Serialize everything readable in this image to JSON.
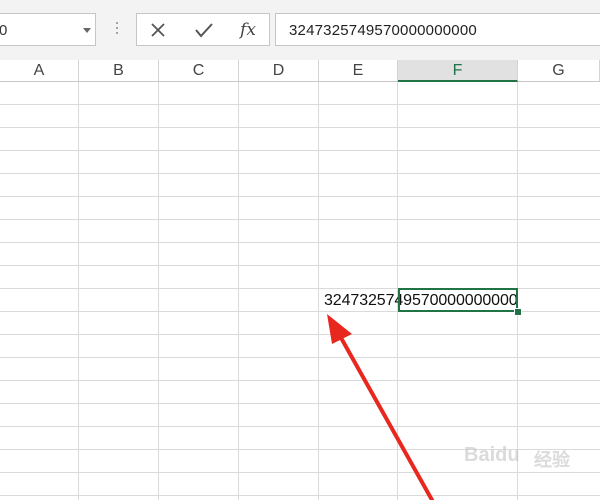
{
  "namebox": {
    "value": "0"
  },
  "formula_bar": {
    "cancel_icon": "close-icon",
    "enter_icon": "checkmark-icon",
    "fx_label": "fx",
    "value": "3247325749570000000000"
  },
  "columns": [
    "A",
    "B",
    "C",
    "D",
    "E",
    "F",
    "G"
  ],
  "selected_column": "F",
  "active_cell": {
    "column": "F",
    "display_value": "3247325749570000000000"
  },
  "annotation": {
    "arrow_color": "#e8281f"
  },
  "accent_color": "#217346",
  "watermark": {
    "logo_text": "Bai",
    "logo_suffix": "du",
    "sub_text": "经验"
  }
}
